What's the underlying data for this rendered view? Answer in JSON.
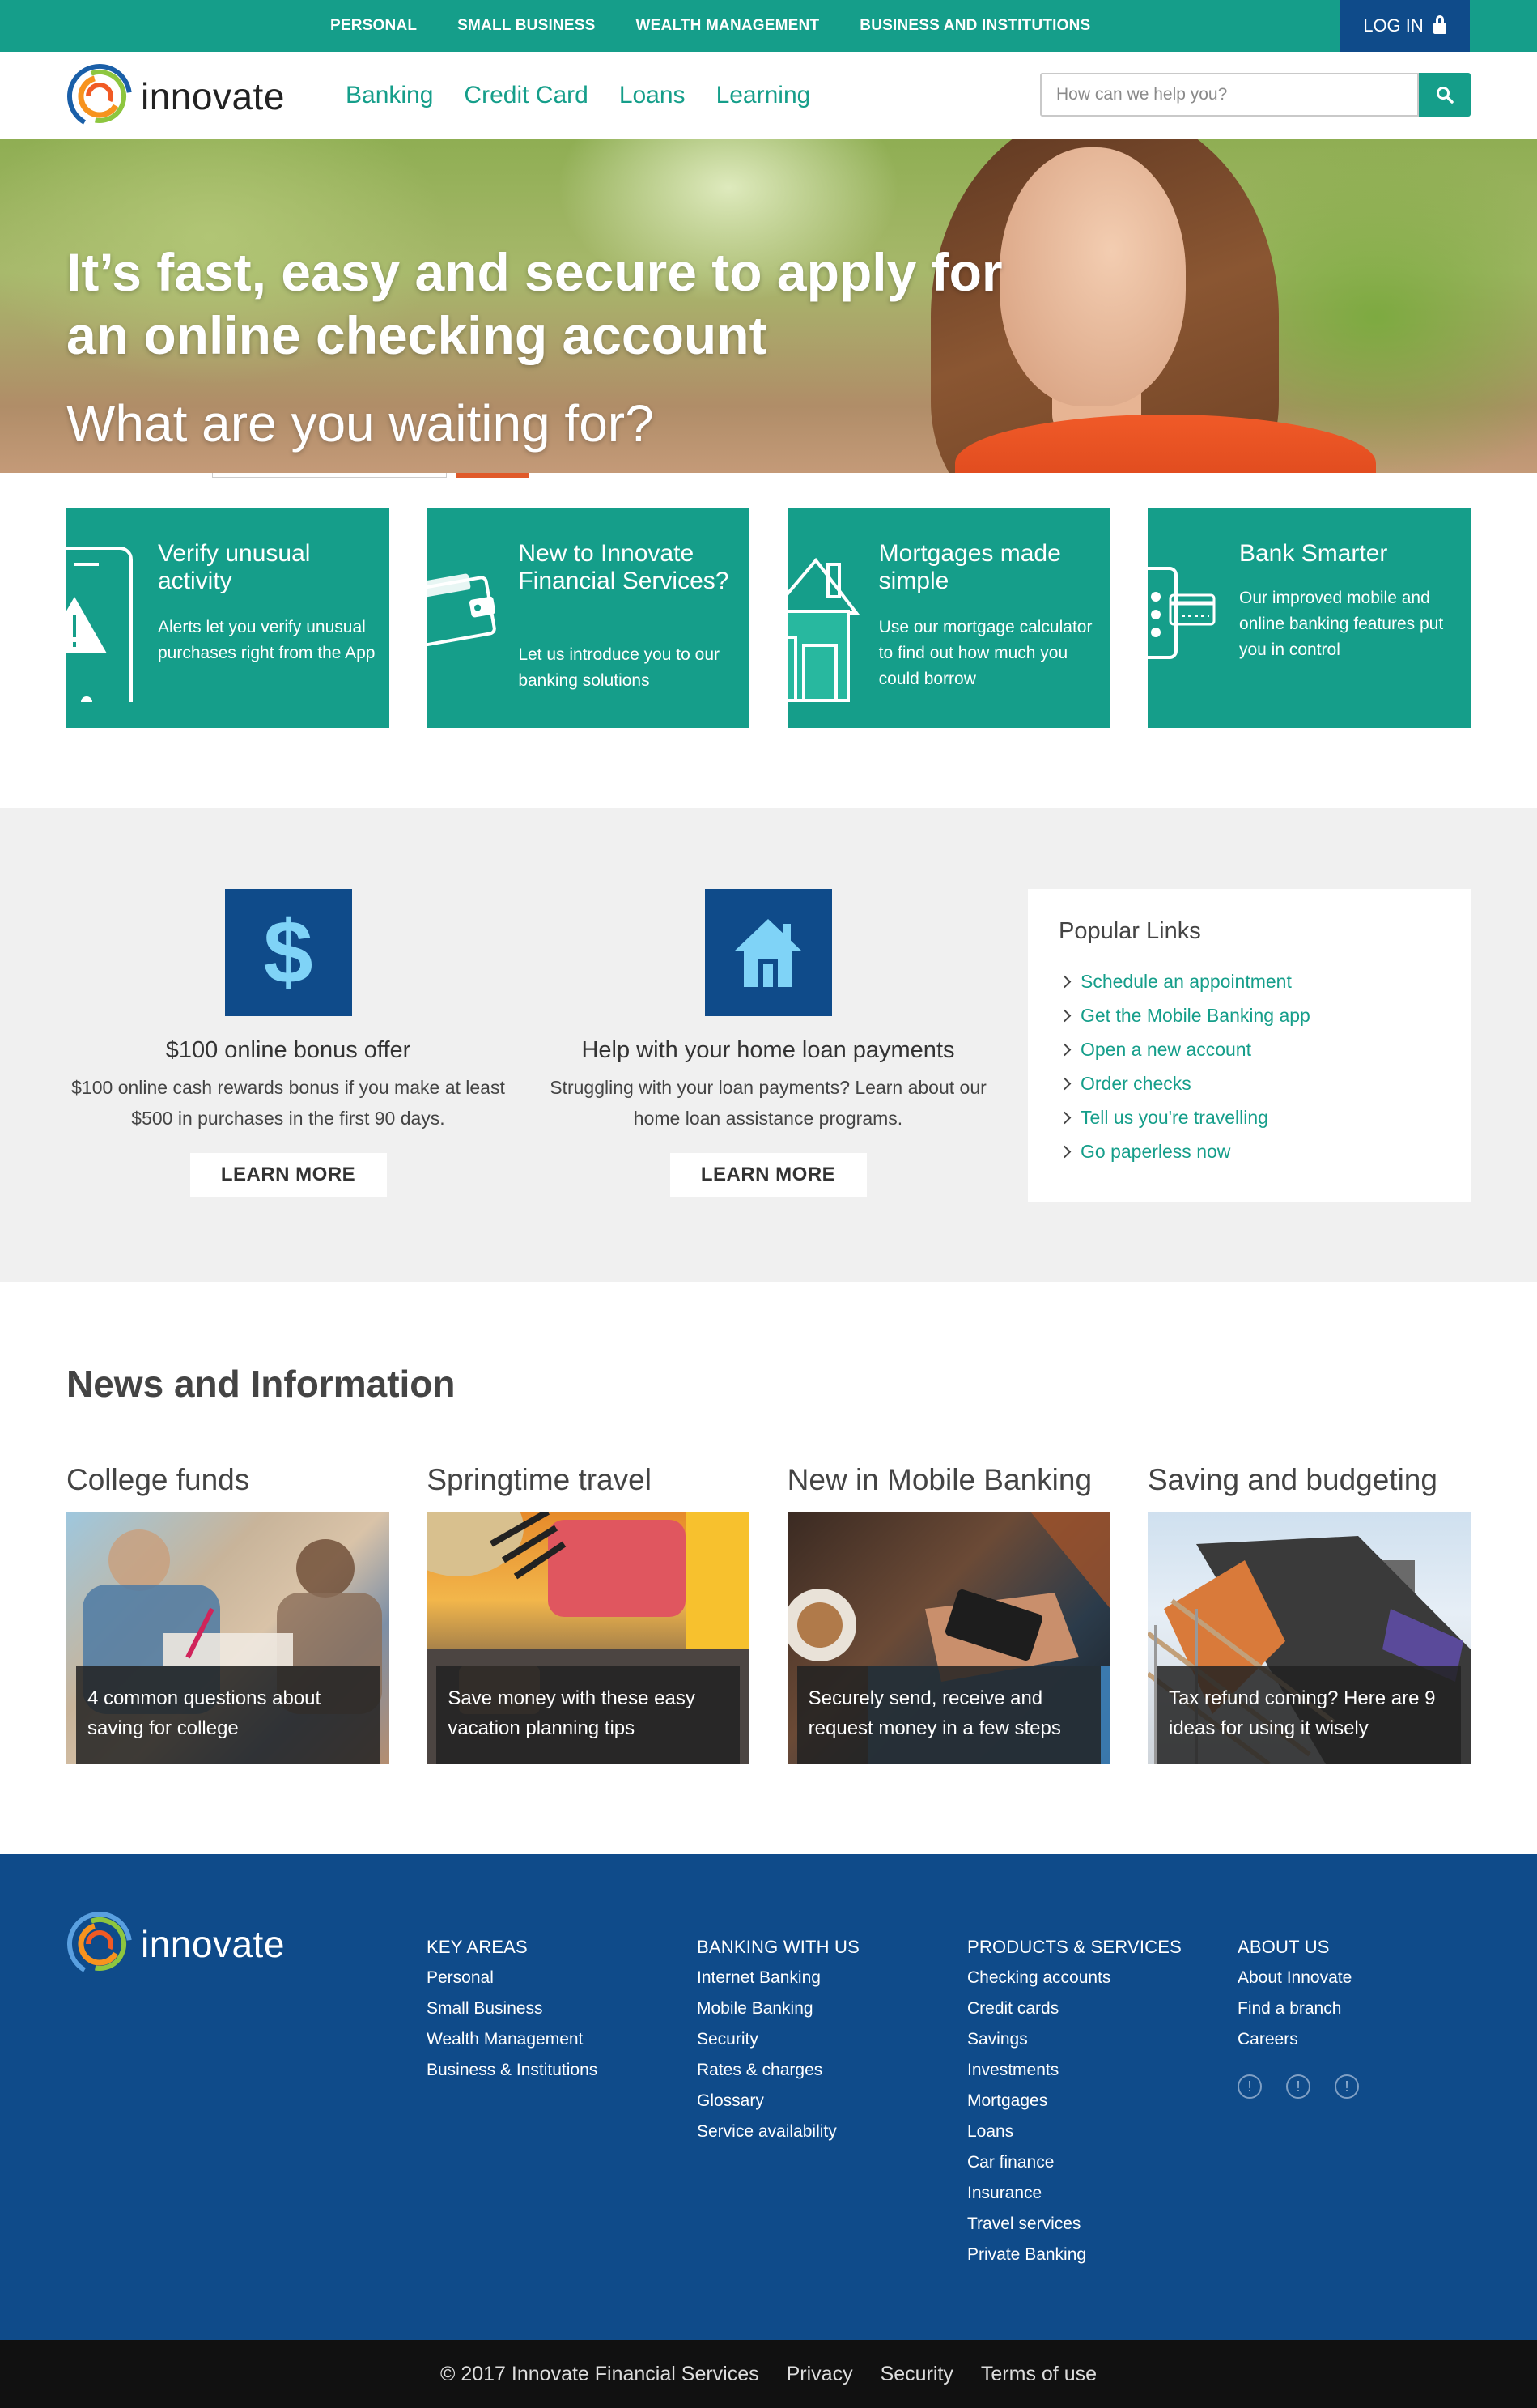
{
  "topbar": {
    "nav": [
      "PERSONAL",
      "SMALL BUSINESS",
      "WEALTH MANAGEMENT",
      "BUSINESS AND INSTITUTIONS"
    ],
    "login": "LOG IN"
  },
  "header": {
    "brand": "innovate",
    "nav": [
      "Banking",
      "Credit Card",
      "Loans",
      "Learning"
    ],
    "search_placeholder": "How can we help you?"
  },
  "hero": {
    "title": "It’s fast, easy and secure to apply for an online checking account",
    "subtitle": "What are you waiting for?"
  },
  "tiles": [
    {
      "title": "Verify unusual activity",
      "text": "Alerts let you verify unusual purchases right from the App",
      "icon": "phone-alert-icon"
    },
    {
      "title": "New to Innovate Financial Services?",
      "text": "Let us introduce you to our banking solutions",
      "icon": "wallet-icon"
    },
    {
      "title": "Mortgages made simple",
      "text": "Use our mortgage calculator to find out how much you could borrow",
      "icon": "house-icon"
    },
    {
      "title": "Bank Smarter",
      "text": "Our improved mobile and online banking features put you in control",
      "icon": "mobile-card-icon"
    }
  ],
  "offers": [
    {
      "title": "$100 online bonus offer",
      "text": "$100 online cash rewards bonus if you make at least $500 in purchases in the first 90 days.",
      "button": "LEARN MORE",
      "icon": "dollar-icon"
    },
    {
      "title": "Help with your home loan payments",
      "text": "Struggling with your loan payments? Learn about our home loan assistance programs.",
      "button": "LEARN MORE",
      "icon": "home-icon"
    }
  ],
  "popular": {
    "title": "Popular Links",
    "links": [
      "Schedule an appointment",
      "Get the Mobile Banking app",
      "Open a new account",
      "Order checks",
      "Tell us you're travelling",
      "Go paperless now"
    ]
  },
  "news": {
    "title": "News and Information",
    "items": [
      {
        "heading": "College funds",
        "caption": "4 common questions about saving for college"
      },
      {
        "heading": "Springtime travel",
        "caption": "Save money with these easy vacation planning tips"
      },
      {
        "heading": "New in Mobile Banking",
        "caption": "Securely send, receive and request money in a few steps"
      },
      {
        "heading": "Saving and budgeting",
        "caption": "Tax refund coming? Here are 9 ideas for using it wisely"
      }
    ]
  },
  "footer": {
    "brand": "innovate",
    "columns": [
      {
        "title": "KEY AREAS",
        "links": [
          "Personal",
          "Small Business",
          "Wealth Management",
          "Business & Institutions"
        ]
      },
      {
        "title": "BANKING WITH US",
        "links": [
          "Internet Banking",
          "Mobile Banking",
          "Security",
          "Rates & charges",
          "Glossary",
          "Service availability"
        ]
      },
      {
        "title": "PRODUCTS & SERVICES",
        "links": [
          "Checking accounts",
          "Credit cards",
          "Savings",
          "Investments",
          "Mortgages",
          "Loans",
          "Car finance",
          "Insurance",
          "Travel services",
          "Private Banking"
        ]
      },
      {
        "title": "ABOUT US",
        "links": [
          "About Innovate",
          "Find a branch",
          "Careers"
        ]
      }
    ],
    "social_glyph": "!",
    "bottom": [
      "© 2017 Innovate Financial Services",
      "Privacy",
      "Security",
      "Terms of use"
    ]
  },
  "colors": {
    "teal": "#159e8a",
    "navy": "#0f4b8a",
    "light_bg": "#f0f0f0"
  }
}
